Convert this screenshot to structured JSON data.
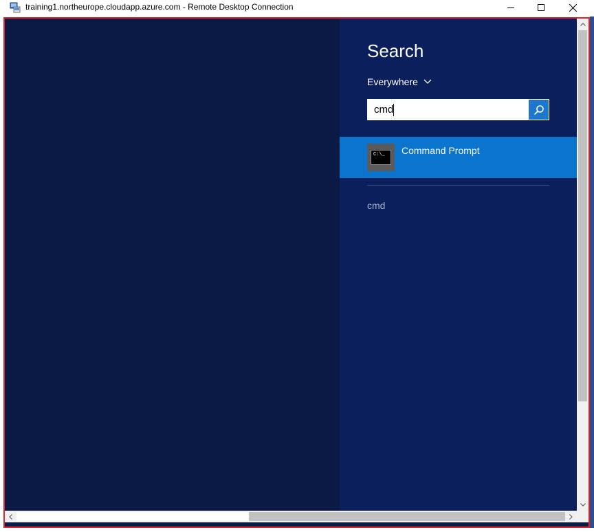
{
  "window": {
    "title": "training1.northeurope.cloudapp.azure.com - Remote Desktop Connection",
    "app_icon": "remote-desktop-icon",
    "controls": {
      "minimize_icon": "minimize-icon",
      "maximize_icon": "maximize-icon",
      "close_icon": "close-icon"
    }
  },
  "search_charm": {
    "title": "Search",
    "scope": {
      "selected": "Everywhere",
      "icon": "chevron-down-icon"
    },
    "search": {
      "value": "cmd",
      "button_icon": "search-icon"
    },
    "results": [
      {
        "label": "Command Prompt",
        "icon": "command-prompt-icon",
        "icon_text": "C:\\_"
      }
    ],
    "suggestions": [
      "cmd"
    ]
  },
  "colors": {
    "desktop_bg": "#0a1a45",
    "charm_bg": "#0a1f5c",
    "result_highlight": "#0b74cd",
    "search_button": "#1e76cf",
    "session_border": "#e3242b"
  }
}
